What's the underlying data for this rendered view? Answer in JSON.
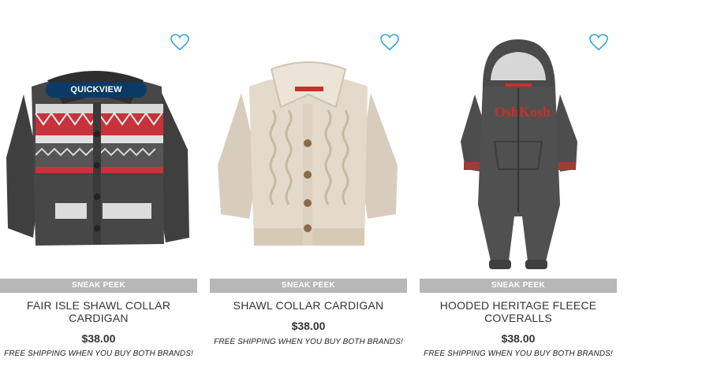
{
  "quickview_label": "QUICKVIEW",
  "products": [
    {
      "badge": "SNEAK PEEK",
      "name": "FAIR ISLE SHAWL COLLAR CARDIGAN",
      "price": "$38.00",
      "shipping_note": "FREE SHIPPING WHEN YOU BUY BOTH BRANDS!",
      "image_icon": "fair-isle-cardigan"
    },
    {
      "badge": "SNEAK PEEK",
      "name": "SHAWL COLLAR CARDIGAN",
      "price": "$38.00",
      "shipping_note": "FREE SHIPPING WHEN YOU BUY BOTH BRANDS!",
      "image_icon": "cable-knit-cardigan"
    },
    {
      "badge": "SNEAK PEEK",
      "name": "HOODED HERITAGE FLEECE COVERALLS",
      "price": "$38.00",
      "shipping_note": "FREE SHIPPING WHEN YOU BUY BOTH BRANDS!",
      "image_icon": "hooded-coveralls"
    }
  ],
  "colors": {
    "heart": "#2aa8d8",
    "quickview_bg": "#0c3a66",
    "badge_bg": "#b7b7b7"
  }
}
